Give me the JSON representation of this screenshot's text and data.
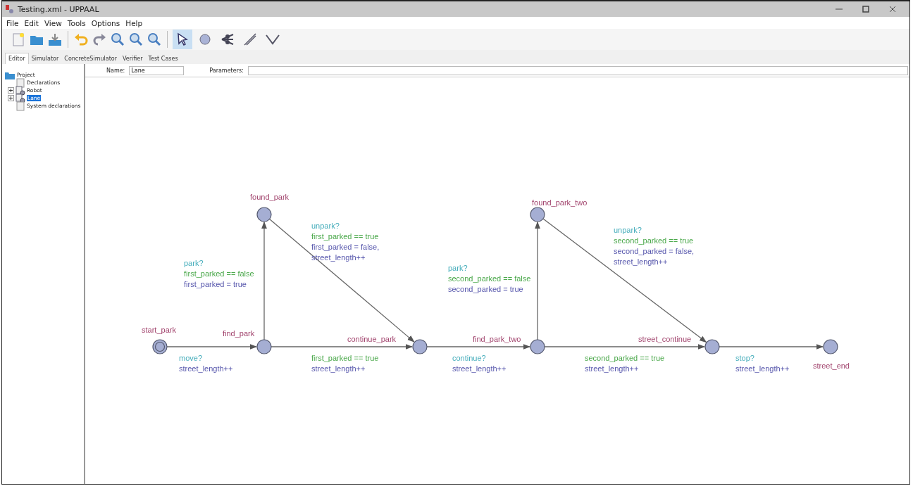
{
  "window": {
    "title": "Testing.xml - UPPAAL"
  },
  "menu": [
    "File",
    "Edit",
    "View",
    "Tools",
    "Options",
    "Help"
  ],
  "tools": [
    {
      "selected": true
    },
    {
      "selected": false
    },
    {
      "selected": false
    },
    {
      "selected": false
    },
    {
      "selected": false
    }
  ],
  "tabs": [
    {
      "label": "Editor",
      "selected": true
    },
    {
      "label": "Simulator",
      "selected": false
    },
    {
      "label": "ConcreteSimulator",
      "selected": false
    },
    {
      "label": "Verifier",
      "selected": false
    },
    {
      "label": "Test Cases",
      "selected": false
    }
  ],
  "tree": {
    "label": "Project",
    "children": [
      {
        "label": "Declarations",
        "kind": "doc",
        "selected": false
      },
      {
        "label": "Robot",
        "kind": "template",
        "expanded": false,
        "selected": false
      },
      {
        "label": "Lane",
        "kind": "template",
        "expanded": false,
        "selected": true
      },
      {
        "label": "System declarations",
        "kind": "doc",
        "selected": false
      }
    ]
  },
  "template": {
    "name_label": "Name:",
    "name": "Lane",
    "parameters_label": "Parameters:"
  },
  "locations": [
    {
      "name": "found_park",
      "initial": false
    },
    {
      "name": "found_park_two",
      "initial": false
    },
    {
      "name": "start_park",
      "initial": true
    },
    {
      "name": "find_park",
      "initial": false
    },
    {
      "name": "continue_park",
      "initial": false
    },
    {
      "name": "find_park_two",
      "initial": false
    },
    {
      "name": "street_continue",
      "initial": false
    },
    {
      "name": "street_end",
      "initial": false
    }
  ],
  "edges": [
    {
      "labels": [
        {
          "kind": "sync",
          "text": "unpark?"
        },
        {
          "kind": "guard",
          "text": "first_parked == true"
        },
        {
          "kind": "update",
          "text": "first_parked = false,"
        },
        {
          "kind": "update",
          "text": "street_length++"
        }
      ]
    },
    {
      "labels": [
        {
          "kind": "sync",
          "text": "unpark?"
        },
        {
          "kind": "guard",
          "text": "second_parked == true"
        },
        {
          "kind": "update",
          "text": "second_parked = false,"
        },
        {
          "kind": "update",
          "text": "street_length++"
        }
      ]
    },
    {
      "labels": [
        {
          "kind": "sync",
          "text": "park?"
        },
        {
          "kind": "guard",
          "text": "first_parked == false"
        },
        {
          "kind": "update",
          "text": "first_parked = true"
        }
      ]
    },
    {
      "labels": [
        {
          "kind": "sync",
          "text": "park?"
        },
        {
          "kind": "guard",
          "text": "second_parked == false"
        },
        {
          "kind": "update",
          "text": "second_parked = true"
        }
      ]
    },
    {
      "labels": [
        {
          "kind": "sync",
          "text": "move?"
        },
        {
          "kind": "update",
          "text": "street_length++"
        }
      ]
    },
    {
      "labels": [
        {
          "kind": "guard",
          "text": "first_parked == true"
        },
        {
          "kind": "update",
          "text": "street_length++"
        }
      ]
    },
    {
      "labels": [
        {
          "kind": "sync",
          "text": "continue?"
        },
        {
          "kind": "update",
          "text": "street_length++"
        }
      ]
    },
    {
      "labels": [
        {
          "kind": "guard",
          "text": "second_parked == true"
        },
        {
          "kind": "update",
          "text": "street_length++"
        }
      ]
    },
    {
      "labels": [
        {
          "kind": "sync",
          "text": "stop?"
        },
        {
          "kind": "update",
          "text": "street_length++"
        }
      ]
    }
  ]
}
